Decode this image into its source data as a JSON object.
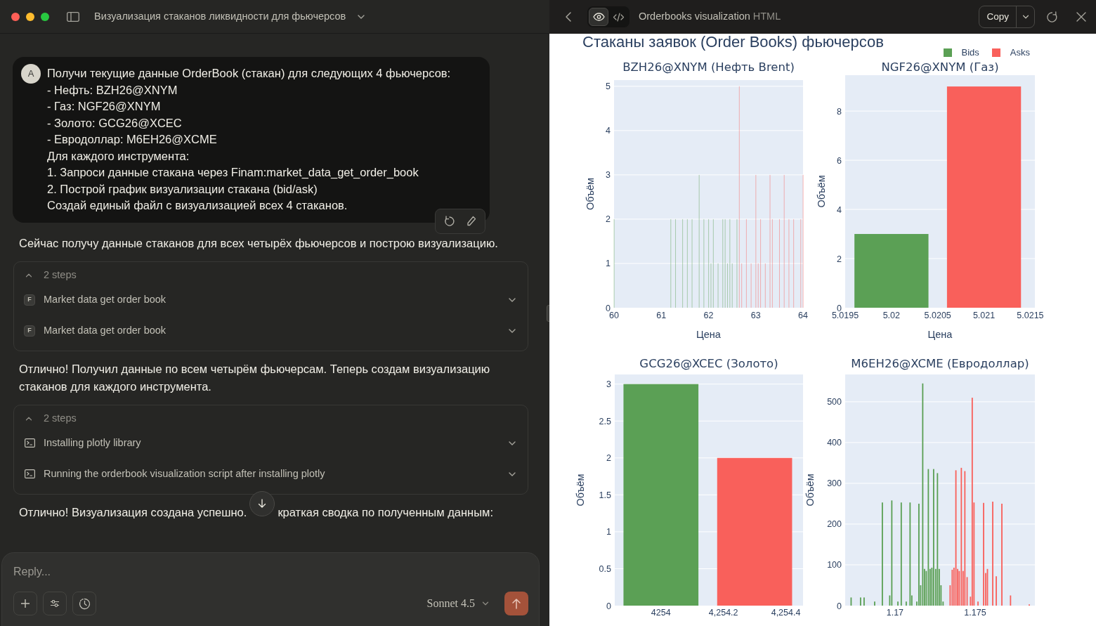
{
  "window": {
    "title": "Визуализация стаканов ликвидности для фьючерсов"
  },
  "conversation": {
    "messages": [
      {
        "kind": "user",
        "avatar": "A",
        "lines": [
          "Получи текущие данные OrderBook (стакан) для следующих 4 фьючерсов:",
          "- Нефть: BZH26@XNYM",
          "- Газ: NGF26@XNYM",
          "- Золото: GCG26@XCEC",
          "- Евродоллар: M6EH26@XCME",
          "Для каждого инструмента:",
          "1. Запроси данные стакана через Finam:market_data_get_order_book",
          "2. Построй график визуализации стакана (bid/ask)",
          "Создай единый файл с визуализацией всех 4 стаканов."
        ]
      },
      {
        "kind": "text",
        "segments": [
          "Сейчас получу данные стаканов для всех четырёх фьючерсов и построю визуализацию."
        ]
      },
      {
        "kind": "steps",
        "summary": "2 steps",
        "expanded": true,
        "steps": [
          {
            "kind": "tool",
            "badge": "F",
            "label": "Market data get order book"
          },
          {
            "kind": "tool",
            "badge": "F",
            "label": "Market data get order book"
          }
        ]
      },
      {
        "kind": "text",
        "segments": [
          "Отлично! Получил данные по всем четырём фьючерсам. Теперь создам визуализацию стаканов для каждого инструмента."
        ]
      },
      {
        "kind": "steps",
        "summary": "2 steps",
        "expanded": true,
        "steps": [
          {
            "kind": "terminal",
            "label": "Installing plotly library"
          },
          {
            "kind": "terminal",
            "label": "Running the orderbook visualization script after installing plotly"
          }
        ]
      },
      {
        "kind": "text",
        "segments": [
          "Отлично! Визуализация создана успешно.",
          "краткая сводка по полученным данным:"
        ]
      }
    ]
  },
  "composer": {
    "placeholder": "Reply...",
    "model": "Sonnet 4.5"
  },
  "artifact": {
    "title": "Orderbooks visualization",
    "type": "HTML",
    "views": [
      {
        "kind": "preview",
        "selected": true
      },
      {
        "kind": "code",
        "selected": false
      }
    ],
    "copy_label": "Copy",
    "page_title": "Стаканы заявок (Order Books) фьючерсов",
    "charts": [
      {
        "chart_data": {
          "type": "bar",
          "title": "BZH26@XNYM (Нефть Brent)",
          "xlabel": "Цена",
          "ylabel": "Объём",
          "grid": true,
          "xlim": [
            60,
            64
          ],
          "ylim": [
            0,
            5.14
          ],
          "xticks": [
            60,
            61,
            62,
            63,
            64
          ],
          "yticks": [
            0,
            1,
            2,
            3,
            4,
            5
          ],
          "x": [
            60.0,
            61.2,
            61.3,
            61.45,
            61.55,
            61.65,
            61.8,
            61.9,
            62.0,
            62.05,
            62.1,
            62.2,
            62.3,
            62.35,
            62.4,
            62.45,
            62.5,
            62.6,
            62.65,
            62.7,
            62.8,
            62.9,
            63.0,
            63.05,
            63.1,
            63.2,
            63.3,
            63.35,
            63.5,
            63.6,
            63.7,
            63.8,
            63.95,
            64.0
          ],
          "series": [
            {
              "name": "Bids",
              "color": "#5ba055",
              "values": [
                2,
                2,
                2,
                2,
                2,
                2,
                3,
                2,
                2,
                1,
                2,
                1,
                2,
                2,
                1,
                2,
                1,
                2,
                null,
                null,
                null,
                null,
                null,
                null,
                null,
                null,
                null,
                null,
                null,
                null,
                null,
                null,
                null,
                null
              ]
            },
            {
              "name": "Asks",
              "color": "#f9605b",
              "values": [
                null,
                null,
                null,
                null,
                null,
                null,
                null,
                null,
                null,
                null,
                null,
                null,
                null,
                null,
                null,
                null,
                null,
                null,
                5,
                1,
                2,
                1,
                3,
                1,
                2,
                1,
                3,
                2,
                2,
                3,
                2,
                2,
                2,
                3
              ]
            }
          ]
        }
      },
      {
        "chart_data": {
          "type": "bar",
          "title": "NGF26@XNYM (Газ)",
          "xlabel": "Цена",
          "ylabel": "Объём",
          "grid": true,
          "xlim": [
            5.0195,
            5.02155
          ],
          "ylim": [
            0,
            9.46
          ],
          "xticks": [
            5.0195,
            5.02,
            5.0205,
            5.021,
            5.0215
          ],
          "yticks": [
            0,
            2,
            4,
            6,
            8
          ],
          "x": [
            5.02,
            5.021
          ],
          "series": [
            {
              "color": "#5ba055",
              "values": [
                3,
                null
              ]
            },
            {
              "color": "#f9605b",
              "values": [
                null,
                9
              ]
            }
          ]
        }
      },
      {
        "chart_data": {
          "type": "bar",
          "title": "GCG26@XCEC (Золото)",
          "ylabel": "Объём",
          "grid": true,
          "xlim": [
            4253.852,
            4254.455
          ],
          "ylim": [
            0,
            3.13
          ],
          "xticks": [
            {
              "value": 4254,
              "label": "4254"
            },
            {
              "value": 4254.2,
              "label": "4,254.2"
            },
            {
              "value": 4254.4,
              "label": "4,254.4"
            }
          ],
          "yticks": [
            0,
            0.5,
            1,
            1.5,
            2,
            2.5,
            3
          ],
          "x": [
            4254,
            4254.3
          ],
          "series": [
            {
              "color": "#5ba055",
              "values": [
                3,
                null
              ]
            },
            {
              "color": "#f9605b",
              "values": [
                null,
                2
              ]
            }
          ]
        }
      },
      {
        "chart_data": {
          "type": "bar",
          "title": "M6EH26@XCME (Евродоллар)",
          "ylabel": "Объём",
          "grid": true,
          "xlim": [
            1.16689,
            1.17873
          ],
          "ylim": [
            0,
            567
          ],
          "xticks": [
            1.17,
            1.175
          ],
          "yticks": [
            0,
            100,
            200,
            300,
            400,
            500
          ],
          "x": [
            1.16726,
            1.16785,
            1.16807,
            1.16873,
            1.16921,
            1.16967,
            1.1698,
            1.17018,
            1.17039,
            1.1707,
            1.17094,
            1.17105,
            1.17136,
            1.17149,
            1.1716,
            1.17173,
            1.17184,
            1.17195,
            1.17208,
            1.17219,
            1.1723,
            1.17241,
            1.17254,
            1.17265,
            1.17276,
            1.17287,
            1.173,
            1.17344,
            1.17357,
            1.17368,
            1.1738,
            1.17391,
            1.17401,
            1.17414,
            1.17425,
            1.17436,
            1.1745,
            1.17471,
            1.17482,
            1.17493,
            1.17518,
            1.17553,
            1.17566,
            1.17577,
            1.1761,
            1.17632,
            1.17667,
            1.17721,
            1.17838
          ],
          "series": [
            {
              "color": "#5ba055",
              "values": [
                20,
                20,
                20,
                10,
                253,
                25,
                258,
                10,
                253,
                10,
                253,
                25,
                10,
                250,
                50,
                545,
                90,
                85,
                335,
                90,
                93,
                335,
                90,
                325,
                90,
                50,
                10,
                null,
                null,
                null,
                null,
                null,
                null,
                null,
                null,
                null,
                null,
                null,
                null,
                null,
                null,
                null,
                null,
                null,
                null,
                null,
                null,
                null,
                null
              ]
            },
            {
              "color": "#f9605b",
              "values": [
                null,
                null,
                null,
                null,
                null,
                null,
                null,
                null,
                null,
                null,
                null,
                null,
                null,
                null,
                null,
                null,
                null,
                null,
                null,
                null,
                null,
                null,
                null,
                null,
                null,
                null,
                null,
                50,
                88,
                93,
                332,
                90,
                85,
                338,
                85,
                330,
                70,
                22,
                510,
                253,
                10,
                252,
                80,
                90,
                255,
                72,
                250,
                25,
                3
              ]
            }
          ]
        }
      }
    ]
  }
}
